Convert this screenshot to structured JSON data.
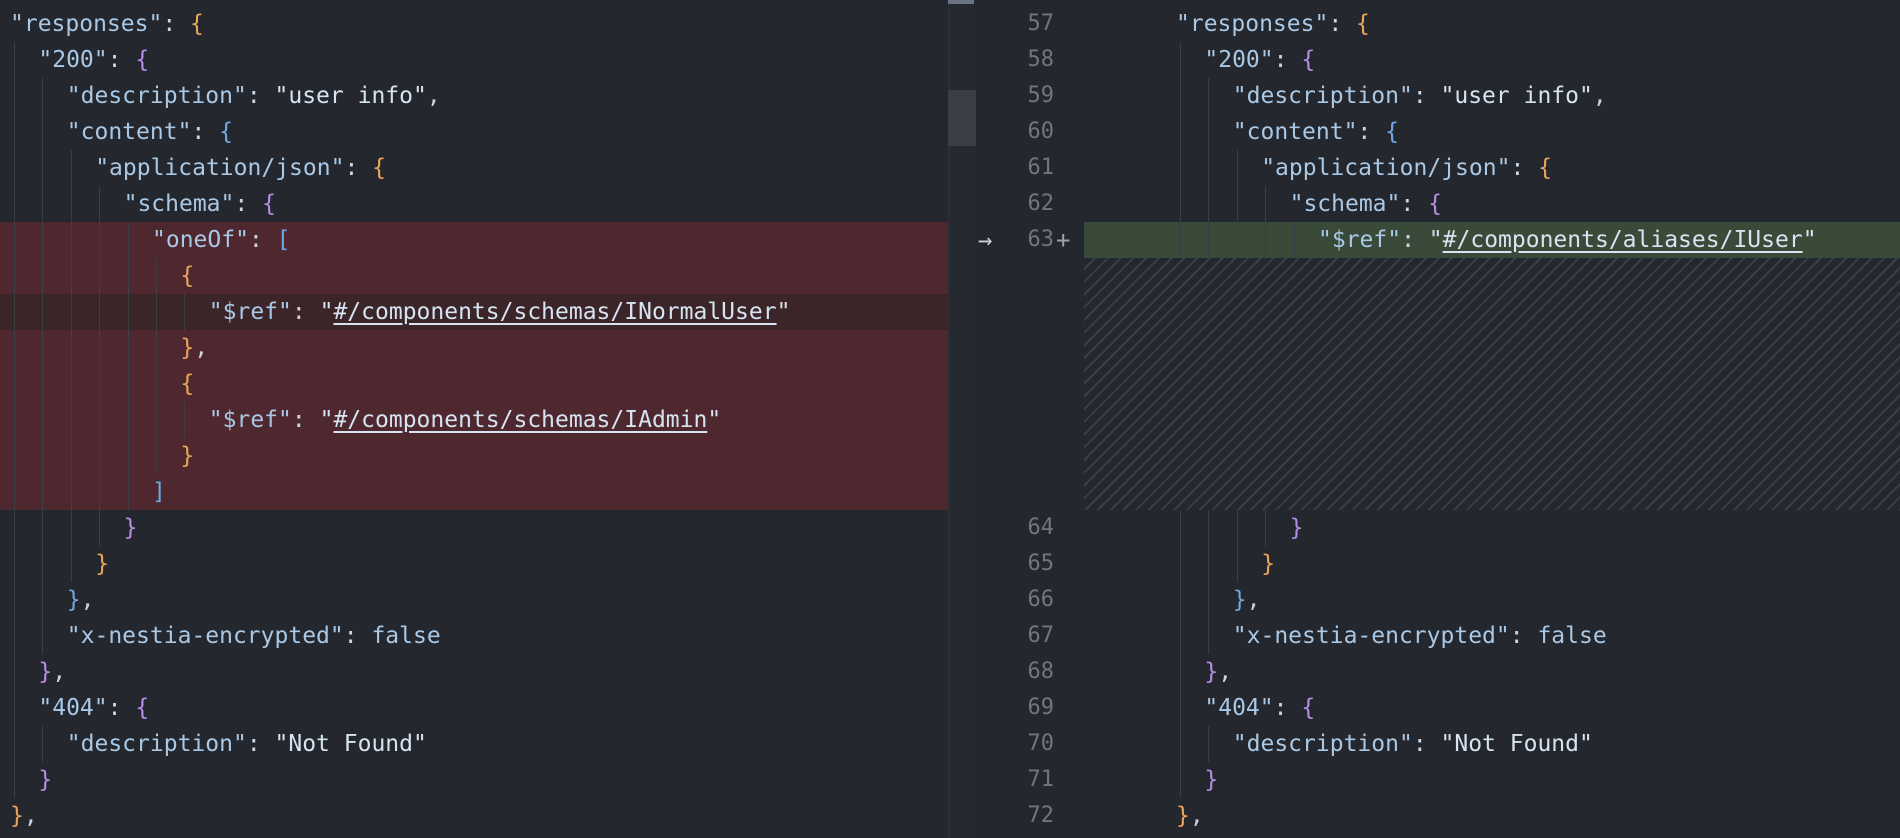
{
  "left_pane": {
    "lines": [
      {
        "indent": 0,
        "key": "\"responses\"",
        "sep": ": ",
        "open": "{",
        "open_color": "or"
      },
      {
        "indent": 1,
        "key": "\"200\"",
        "sep": ": ",
        "open": "{",
        "open_color": "pu"
      },
      {
        "indent": 2,
        "key": "\"description\"",
        "sep": ": ",
        "value": "\"user info\"",
        "tail": ","
      },
      {
        "indent": 2,
        "key": "\"content\"",
        "sep": ": ",
        "open": "{",
        "open_color": "bl"
      },
      {
        "indent": 3,
        "key": "\"application/json\"",
        "sep": ": ",
        "open": "{",
        "open_color": "or"
      },
      {
        "indent": 4,
        "key": "\"schema\"",
        "sep": ": ",
        "open": "{",
        "open_color": "pu"
      },
      {
        "indent": 5,
        "key": "\"oneOf\"",
        "sep": ": ",
        "open": "[",
        "open_color": "bl",
        "deleted": true
      },
      {
        "indent": 6,
        "open": "{",
        "open_color": "or",
        "deleted": true
      },
      {
        "indent": 7,
        "key": "\"$ref\"",
        "sep": ": ",
        "quote": "\"",
        "link": "#/components/schemas/INormalUser",
        "deleted": true
      },
      {
        "indent": 6,
        "open": "}",
        "open_color": "or",
        "tail": ",",
        "deleted": true
      },
      {
        "indent": 6,
        "open": "{",
        "open_color": "or",
        "deleted": true
      },
      {
        "indent": 7,
        "key": "\"$ref\"",
        "sep": ": ",
        "quote": "\"",
        "link": "#/components/schemas/IAdmin",
        "deleted": true
      },
      {
        "indent": 6,
        "open": "}",
        "open_color": "or",
        "deleted": true
      },
      {
        "indent": 5,
        "open": "]",
        "open_color": "bl",
        "deleted": true
      },
      {
        "indent": 4,
        "open": "}",
        "open_color": "pu"
      },
      {
        "indent": 3,
        "open": "}",
        "open_color": "or"
      },
      {
        "indent": 2,
        "open": "}",
        "open_color": "bl",
        "tail": ","
      },
      {
        "indent": 2,
        "key": "\"x-nestia-encrypted\"",
        "sep": ": ",
        "value": "false",
        "literal": true
      },
      {
        "indent": 1,
        "open": "}",
        "open_color": "pu",
        "tail": ","
      },
      {
        "indent": 1,
        "key": "\"404\"",
        "sep": ": ",
        "open": "{",
        "open_color": "pu"
      },
      {
        "indent": 2,
        "key": "\"description\"",
        "sep": ": ",
        "value": "\"Not Found\""
      },
      {
        "indent": 1,
        "open": "}",
        "open_color": "pu"
      },
      {
        "indent": 0,
        "open": "}",
        "open_color": "or",
        "tail": ","
      }
    ]
  },
  "right_pane": {
    "lines": [
      {
        "num": "57",
        "slot": 0,
        "indent": 0,
        "key": "\"responses\"",
        "sep": ": ",
        "open": "{",
        "open_color": "or"
      },
      {
        "num": "58",
        "slot": 1,
        "indent": 1,
        "key": "\"200\"",
        "sep": ": ",
        "open": "{",
        "open_color": "pu"
      },
      {
        "num": "59",
        "slot": 2,
        "indent": 2,
        "key": "\"description\"",
        "sep": ": ",
        "value": "\"user info\"",
        "tail": ","
      },
      {
        "num": "60",
        "slot": 3,
        "indent": 2,
        "key": "\"content\"",
        "sep": ": ",
        "open": "{",
        "open_color": "bl"
      },
      {
        "num": "61",
        "slot": 4,
        "indent": 3,
        "key": "\"application/json\"",
        "sep": ": ",
        "open": "{",
        "open_color": "or"
      },
      {
        "num": "62",
        "slot": 5,
        "indent": 4,
        "key": "\"schema\"",
        "sep": ": ",
        "open": "{",
        "open_color": "pu"
      },
      {
        "num": "63",
        "slot": 6,
        "indent": 5,
        "key": "\"$ref\"",
        "sep": ": ",
        "quote": "\"",
        "link": "#/components/aliases/IUser",
        "added": true
      },
      {
        "num": "64",
        "slot": 14,
        "indent": 4,
        "open": "}",
        "open_color": "pu"
      },
      {
        "num": "65",
        "slot": 15,
        "indent": 3,
        "open": "}",
        "open_color": "or"
      },
      {
        "num": "66",
        "slot": 16,
        "indent": 2,
        "open": "}",
        "open_color": "bl",
        "tail": ","
      },
      {
        "num": "67",
        "slot": 17,
        "indent": 2,
        "key": "\"x-nestia-encrypted\"",
        "sep": ": ",
        "value": "false",
        "literal": true
      },
      {
        "num": "68",
        "slot": 18,
        "indent": 1,
        "open": "}",
        "open_color": "pu",
        "tail": ","
      },
      {
        "num": "69",
        "slot": 19,
        "indent": 1,
        "key": "\"404\"",
        "sep": ": ",
        "open": "{",
        "open_color": "pu"
      },
      {
        "num": "70",
        "slot": 20,
        "indent": 2,
        "key": "\"description\"",
        "sep": ": ",
        "value": "\"Not Found\""
      },
      {
        "num": "71",
        "slot": 21,
        "indent": 1,
        "open": "}",
        "open_color": "pu"
      },
      {
        "num": "72",
        "slot": 22,
        "indent": 0,
        "open": "}",
        "open_color": "or",
        "tail": ","
      }
    ],
    "change_arrow": "→",
    "change_plus": "+"
  },
  "colors": {
    "background": "#24272d",
    "deleted_block": "#4e282e",
    "added_line": "#3a4a38",
    "bracket_orange": "#e8a55b",
    "bracket_purple": "#b98ce6",
    "bracket_blue": "#6fa8e6"
  },
  "icons": {
    "change_marker": "right-arrow-icon",
    "add_marker": "plus-icon"
  }
}
